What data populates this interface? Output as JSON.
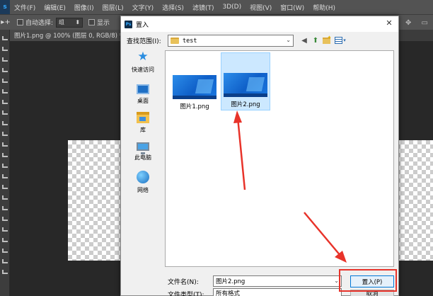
{
  "ps": {
    "logo": "s",
    "menu": [
      "文件(F)",
      "编辑(E)",
      "图像(I)",
      "图层(L)",
      "文字(Y)",
      "选择(S)",
      "滤镜(T)",
      "3D(D)",
      "视图(V)",
      "窗口(W)",
      "帮助(H)"
    ],
    "options": {
      "tool_glyph": "▸+",
      "auto_select_label": "自动选择:",
      "auto_select_value": "组",
      "show_label": "显示"
    },
    "doc_tab": "图片1.png @ 100% (图层 0, RGB/8) *  ×"
  },
  "dialog": {
    "title": "置入",
    "app_icon_text": "Ps",
    "look_in_label": "查找范围(I):",
    "look_in_value": "test",
    "places": [
      {
        "id": "quick",
        "label": "快速访问"
      },
      {
        "id": "desktop",
        "label": "桌面"
      },
      {
        "id": "library",
        "label": "库"
      },
      {
        "id": "pc",
        "label": "此电脑"
      },
      {
        "id": "network",
        "label": "网络"
      }
    ],
    "files": [
      {
        "name": "图片1.png",
        "selected": false
      },
      {
        "name": "图片2.png",
        "selected": true
      }
    ],
    "file_name_label": "文件名(N):",
    "file_name_value": "图片2.png",
    "file_type_label": "文件类型(T):",
    "file_type_value": "所有格式",
    "place_button": "置入(P)",
    "cancel_button": "取消"
  },
  "colors": {
    "annotation_red": "#e8332a",
    "selection_blue": "#cce8ff",
    "primary_border": "#0078d7"
  }
}
